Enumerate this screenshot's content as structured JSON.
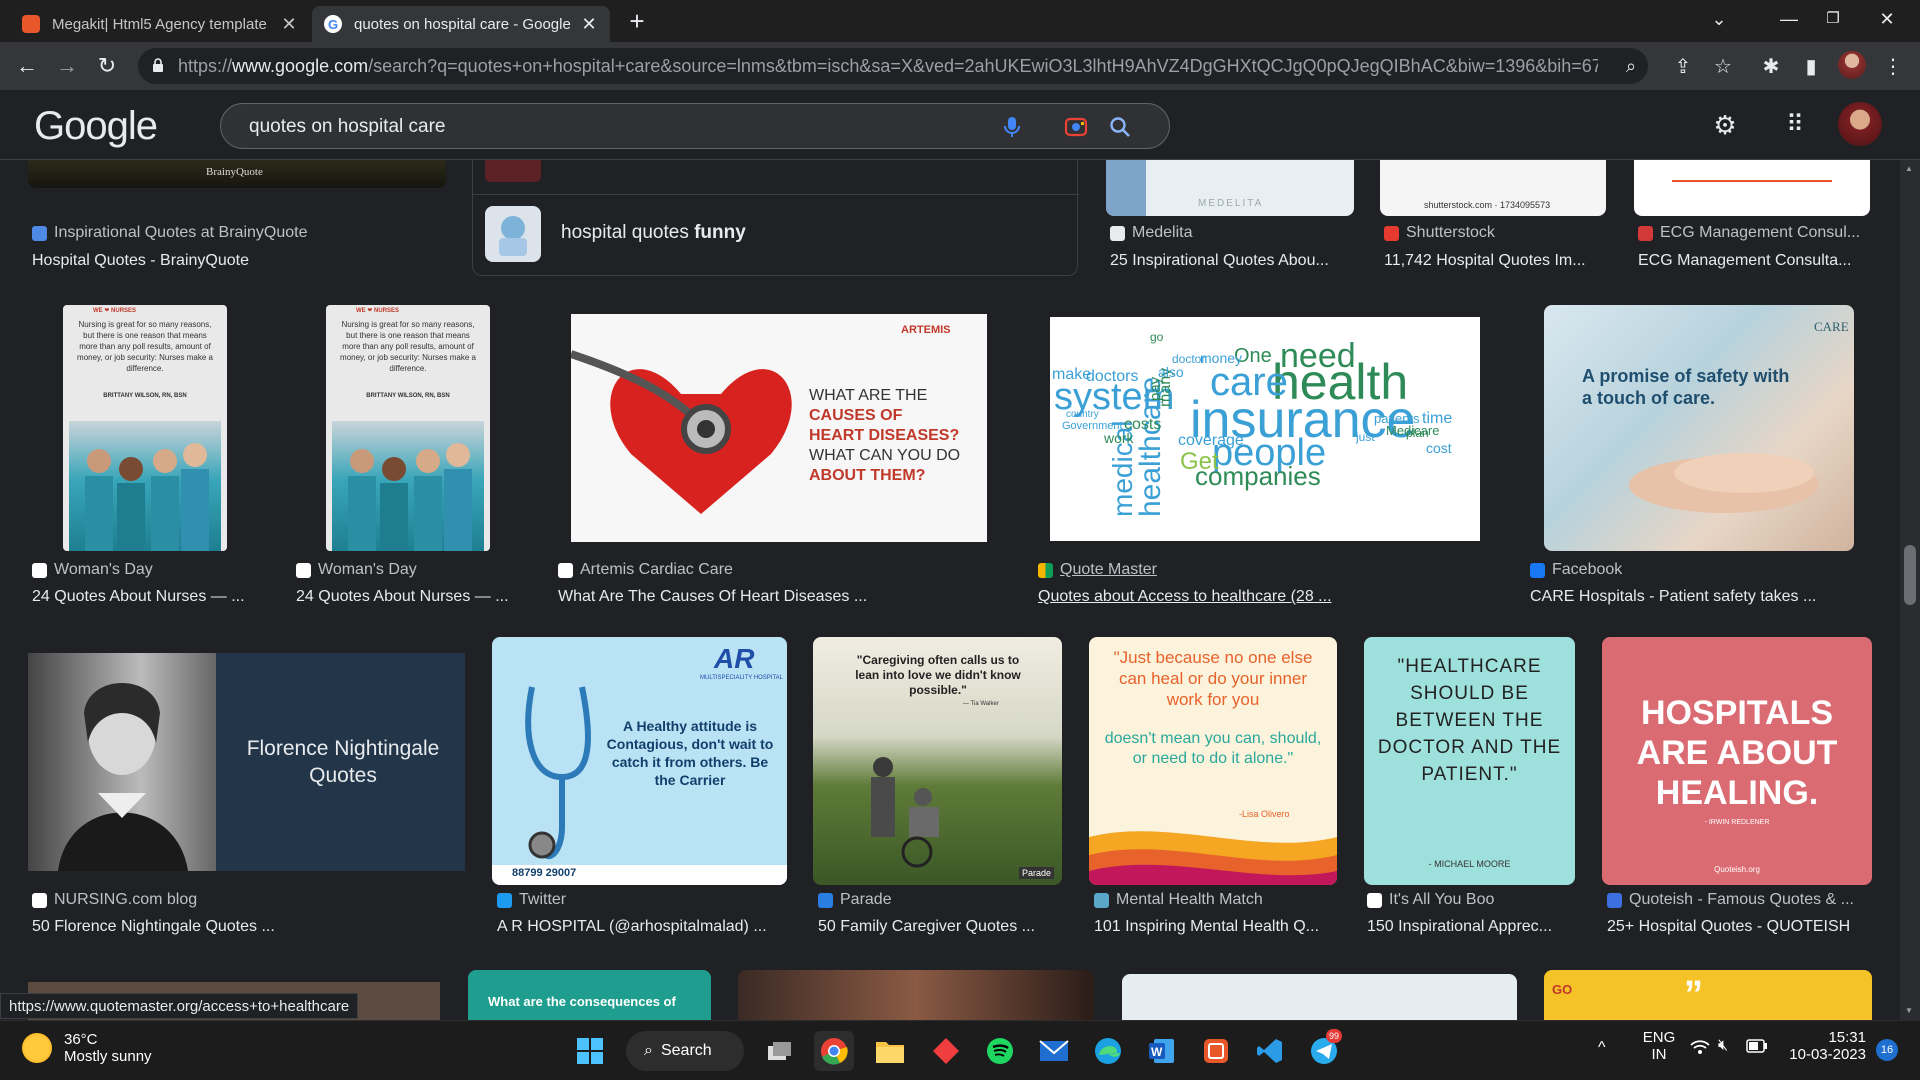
{
  "browser": {
    "tabs": [
      {
        "title": "Megakit| Html5 Agency template",
        "active": false
      },
      {
        "title": "quotes on hospital care - Google",
        "active": true
      }
    ],
    "url_prefix": "https://",
    "url_domain": "www.google.com",
    "url_rest": "/search?q=quotes+on+hospital+care&source=lnms&tbm=isch&sa=X&ved=2ahUKEwiO3L3lhtH9AhVZ4DgGHXtQCJgQ0pQJegQIBhAC&biw=1396&bih=678&d..."
  },
  "google": {
    "logo": "Google",
    "query": "quotes on hospital care"
  },
  "related": {
    "prefix": "hospital quotes ",
    "bold": "funny"
  },
  "row0": [
    {
      "source": "Inspirational Quotes at BrainyQuote",
      "caption": "Hospital Quotes - BrainyQuote",
      "thumb_text": "BrainyQuote"
    },
    {
      "source": "Medelita",
      "caption": "25 Inspirational Quotes Abou...",
      "thumb_text": "MEDELITA"
    },
    {
      "source": "Shutterstock",
      "caption": "11,742 Hospital Quotes Im...",
      "thumb_text": "shutterstock.com · 1734095573"
    },
    {
      "source": "ECG Management Consul...",
      "caption": "ECG Management Consulta..."
    }
  ],
  "row1": [
    {
      "source": "Woman's Day",
      "caption": "24 Quotes About Nurses — ...",
      "quote": "Nursing is great for so many reasons, but there is one reason that means more than any poll results, amount of money, or job security: Nurses make a difference.",
      "author": "BRITTANY WILSON, RN, BSN",
      "brand": "WE ❤ NURSES"
    },
    {
      "source": "Woman's Day",
      "caption": "24 Quotes About Nurses — ...",
      "quote": "Nursing is great for so many reasons, but there is one reason that means more than any poll results, amount of money, or job security: Nurses make a difference.",
      "author": "BRITTANY WILSON, RN, BSN",
      "brand": "WE ❤ NURSES"
    },
    {
      "source": "Artemis Cardiac Care",
      "caption": "What Are The Causes Of Heart Diseases ...",
      "line1": "WHAT ARE THE",
      "line2": "CAUSES OF",
      "line3": "HEART DISEASES?",
      "line4": "WHAT CAN YOU DO",
      "line5": "ABOUT THEM?",
      "brand": "ARTEMIS"
    },
    {
      "source": "Quote Master",
      "caption": "Quotes about Access to healthcare (28 ..."
    },
    {
      "source": "Facebook",
      "caption": "CARE Hospitals - Patient safety takes ...",
      "text": "A promise of safety with a touch of care.",
      "brand": "CARE"
    }
  ],
  "wordcloud": [
    "need",
    "health",
    "insurance",
    "care",
    "system",
    "people",
    "healthcare",
    "companies",
    "medical",
    "Get",
    "One",
    "coverage",
    "costs",
    "doctors",
    "money",
    "cost",
    "time",
    "plan",
    "Medicare",
    "just",
    "patients",
    "Government",
    "country",
    "work",
    "make",
    "pay",
    "many",
    "also",
    "doctor",
    "go"
  ],
  "row2": [
    {
      "source": "NURSING.com blog",
      "caption": "50 Florence Nightingale Quotes ...",
      "text": "Florence Nightingale Quotes"
    },
    {
      "source": "Twitter",
      "caption": "A R HOSPITAL (@arhospitalmalad) ...",
      "text": "A Healthy attitude is Contagious, don't wait to catch it from others. Be the Carrier",
      "phone": "88799 29007",
      "brand": "AR",
      "brand_sub": "MULTISPECIALITY HOSPITAL"
    },
    {
      "source": "Parade",
      "caption": "50 Family Caregiver Quotes ...",
      "text": "\"Caregiving often calls us to lean into love we didn't know possible.\"",
      "author": "— Tia Walker",
      "brand": "Parade"
    },
    {
      "source": "Mental Health Match",
      "caption": "101 Inspiring Mental Health Q...",
      "text1": "\"Just because no one else can heal or do your inner work for you",
      "text2": "doesn't mean you can, should, or need to do it alone.\"",
      "author": "-Lisa Olivero"
    },
    {
      "source": "It's All You Boo",
      "caption": "150 Inspirational Apprec...",
      "text": "\"HEALTHCARE SHOULD BE BETWEEN THE DOCTOR AND THE PATIENT.\"",
      "author": "- MICHAEL MOORE"
    },
    {
      "source": "Quoteish - Famous Quotes & ...",
      "caption": "25+ Hospital Quotes - QUOTEISH",
      "text": "HOSPITALS ARE ABOUT HEALING.",
      "author": "- IRWIN REDLENER",
      "brand": "Quoteish.org"
    }
  ],
  "row3": [
    {
      "text": "What are the consequences of"
    },
    {
      "text": "GO"
    }
  ],
  "status_url": "https://www.quotemaster.org/access+to+healthcare",
  "taskbar": {
    "temp": "36°C",
    "weather": "Mostly sunny",
    "search": "Search",
    "lang1": "ENG",
    "lang2": "IN",
    "time": "15:31",
    "date": "10-03-2023",
    "notif": "16",
    "badge": "99"
  }
}
